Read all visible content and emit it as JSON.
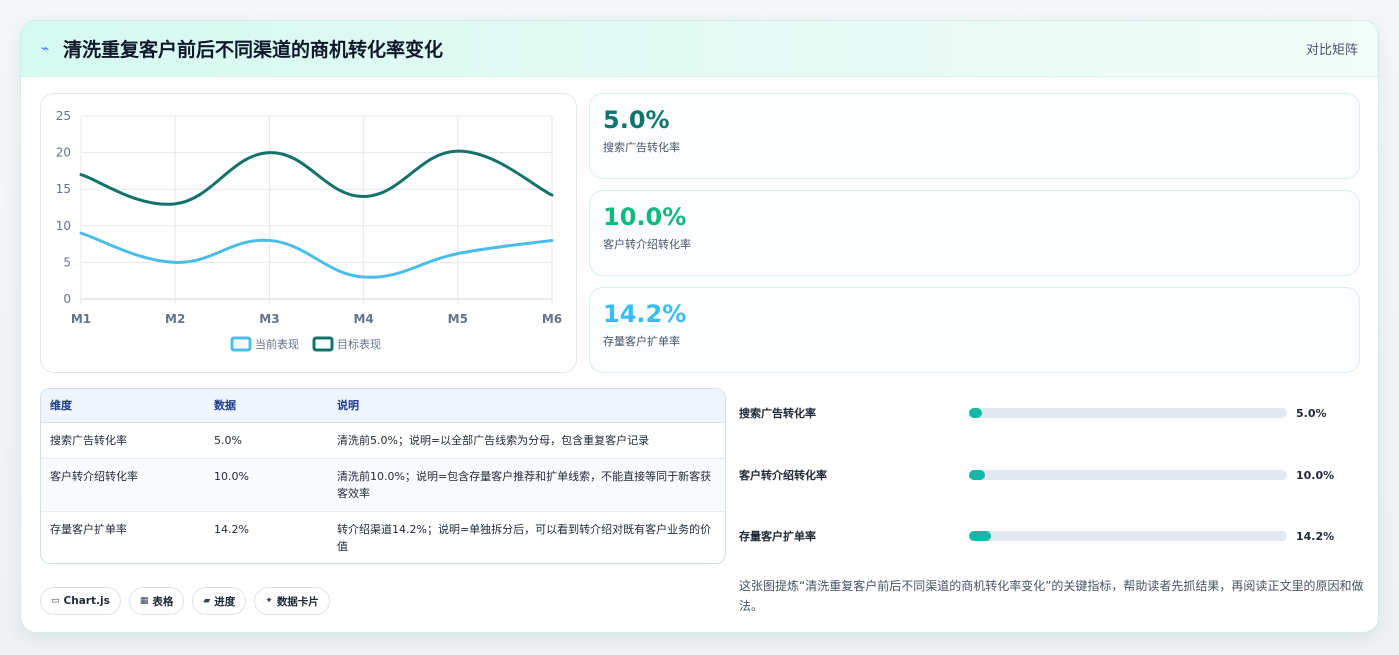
{
  "header": {
    "icon": "line-chart-icon",
    "title": "清洗重复客户前后不同渠道的商机转化率变化",
    "link_label": "对比矩阵"
  },
  "chart_data": {
    "type": "line",
    "categories": [
      "M1",
      "M2",
      "M3",
      "M4",
      "M5",
      "M6"
    ],
    "ylim": [
      0,
      25
    ],
    "yticks": [
      0,
      5,
      10,
      15,
      20,
      25
    ],
    "grid": true,
    "legend_position": "bottom",
    "series": [
      {
        "name": "当前表现",
        "values": [
          9,
          5,
          8,
          3,
          6.2,
          8
        ],
        "color": "#4bbde9"
      },
      {
        "name": "目标表现",
        "values": [
          17,
          13,
          20,
          14,
          20.2,
          14.2
        ],
        "color": "#15726b"
      }
    ]
  },
  "metrics": [
    {
      "value": "5.0%",
      "label": "搜索广告转化率",
      "color": "#0f766e"
    },
    {
      "value": "10.0%",
      "label": "客户转介绍转化率",
      "color": "#10b981"
    },
    {
      "value": "14.2%",
      "label": "存量客户扩单率",
      "color": "#38bdf8"
    }
  ],
  "table": {
    "headers": [
      "维度",
      "数据",
      "说明"
    ],
    "rows": [
      [
        "搜索广告转化率",
        "5.0%",
        "清洗前5.0%；说明=以全部广告线索为分母，包含重复客户记录"
      ],
      [
        "客户转介绍转化率",
        "10.0%",
        "清洗前10.0%；说明=包含存量客户推荐和扩单线索，不能直接等同于新客获客效率"
      ],
      [
        "存量客户扩单率",
        "14.2%",
        "转介绍渠道14.2%；说明=单独拆分后，可以看到转介绍对既有客户业务的价值"
      ]
    ]
  },
  "progress": [
    {
      "label": "搜索广告转化率",
      "value": "5.0%",
      "fraction": 0.04
    },
    {
      "label": "客户转介绍转化率",
      "value": "10.0%",
      "fraction": 0.05
    },
    {
      "label": "存量客户扩单率",
      "value": "14.2%",
      "fraction": 0.07
    }
  ],
  "progress_color": "#14b8a6",
  "summary": "这张图提炼“清洗重复客户前后不同渠道的商机转化率变化”的关键指标，帮助读者先抓结果，再阅读正文里的原因和做法。",
  "chips": [
    {
      "icon": "monitor-icon",
      "glyph": "▭",
      "label": "Chart.js"
    },
    {
      "icon": "table-icon",
      "glyph": "▦",
      "label": "表格"
    },
    {
      "icon": "folder-icon",
      "glyph": "▰",
      "label": "进度"
    },
    {
      "icon": "sparkle-icon",
      "glyph": "✦",
      "label": "数据卡片"
    }
  ]
}
